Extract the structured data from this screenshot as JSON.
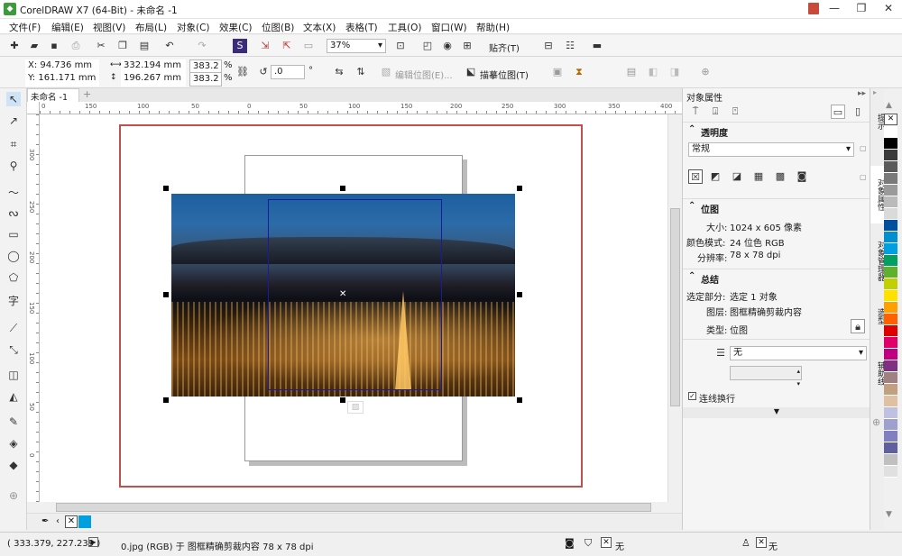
{
  "window": {
    "title": "CorelDRAW X7 (64-Bit) - 未命名 -1",
    "minimize": "—",
    "restore": "❐",
    "close": "✕"
  },
  "menu": [
    "文件(F)",
    "编辑(E)",
    "视图(V)",
    "布局(L)",
    "对象(C)",
    "效果(C)",
    "位图(B)",
    "文本(X)",
    "表格(T)",
    "工具(O)",
    "窗口(W)",
    "帮助(H)"
  ],
  "toolbar": {
    "zoom": "37%",
    "snap_label": "贴齐(T)"
  },
  "propbar": {
    "x": "X: 94.736 mm",
    "y": "Y: 161.171 mm",
    "w": "332.194 mm",
    "h": "196.267 mm",
    "sx": "383.2",
    "sy": "383.2",
    "pct": "%",
    "angle": ".0",
    "deg": "°",
    "edit_bitmap": "编辑位图(E)...",
    "trace_bitmap": "描摹位图(T)"
  },
  "doc_tab": "未命名 -1",
  "ruler_h": [
    "0",
    "150",
    "100",
    "50",
    "0",
    "50",
    "100",
    "150",
    "200",
    "250",
    "300",
    "350",
    "400"
  ],
  "ruler_v": [
    "300",
    "250",
    "200",
    "150",
    "100",
    "50",
    "0"
  ],
  "panel": {
    "title": "对象属性",
    "transparency": {
      "title": "透明度",
      "mode": "常规"
    },
    "bitmap": {
      "title": "位图",
      "size_label": "大小:",
      "size_value": "1024 x 605 像素",
      "color_label": "颜色模式:",
      "color_value": "24 位色 RGB",
      "res_label": "分辨率:",
      "res_value": "78 x 78 dpi"
    },
    "summary": {
      "title": "总结",
      "sel_label": "选定部分:",
      "sel_value": "选定 1 对象",
      "layer_label": "图层:",
      "layer_value": "图框精确剪裁内容",
      "type_label": "类型:",
      "type_value": "位图"
    },
    "wrap_value": "无",
    "wrap_line": "连线换行"
  },
  "vtabs": [
    "提示",
    "对象属性",
    "对象管理器",
    "造型",
    "辅助线"
  ],
  "palette": [
    "#ffffff",
    "#000000",
    "#3a3a3a",
    "#5a5a5a",
    "#7a7a7a",
    "#9a9a9a",
    "#bababa",
    "#dadada",
    "#0050a0",
    "#0090d0",
    "#00a0e0",
    "#00a060",
    "#60b030",
    "#c0d000",
    "#ffe000",
    "#ffa000",
    "#ff6000",
    "#e00000",
    "#e0006a",
    "#c00080",
    "#803080",
    "#a08080",
    "#c0a080",
    "#e0c0a0",
    "#c0c0e0",
    "#a0a0d0",
    "#8080c0",
    "#6060a0",
    "#c0c0c0",
    "#e0e0e0"
  ],
  "status": {
    "coords": "( 333.379, 227.239 )",
    "info": "0.jpg (RGB) 于 图框精确剪裁内容 78 x 78 dpi",
    "fill": "无",
    "outline": "无"
  }
}
